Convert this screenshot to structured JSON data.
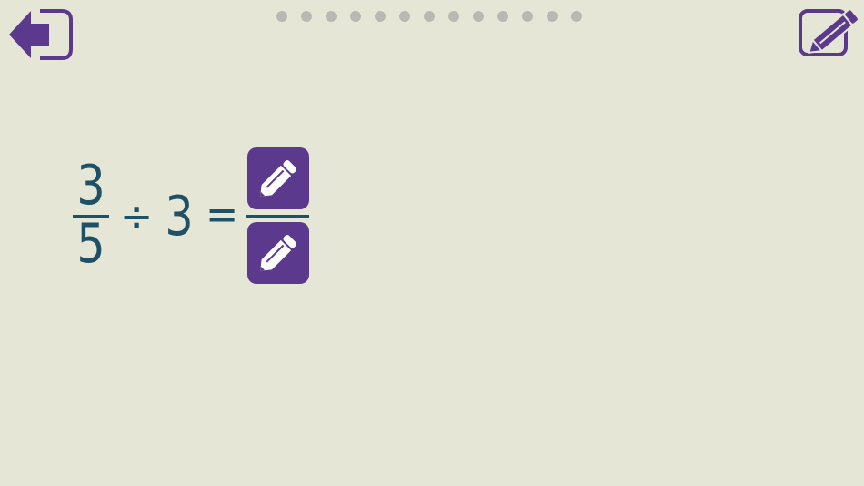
{
  "nav": {
    "back_icon": "back-arrow-icon",
    "edit_icon": "edit-pencil-icon",
    "progress_dots": 13,
    "accent_color": "#5b3a8e",
    "dot_color": "#b9b9b3"
  },
  "equation": {
    "numerator": "3",
    "denominator": "5",
    "operator": "÷",
    "divisor": "3",
    "equals": "=",
    "text_color": "#1e5066"
  },
  "answer": {
    "numerator_icon": "pencil-icon",
    "denominator_icon": "pencil-icon"
  }
}
